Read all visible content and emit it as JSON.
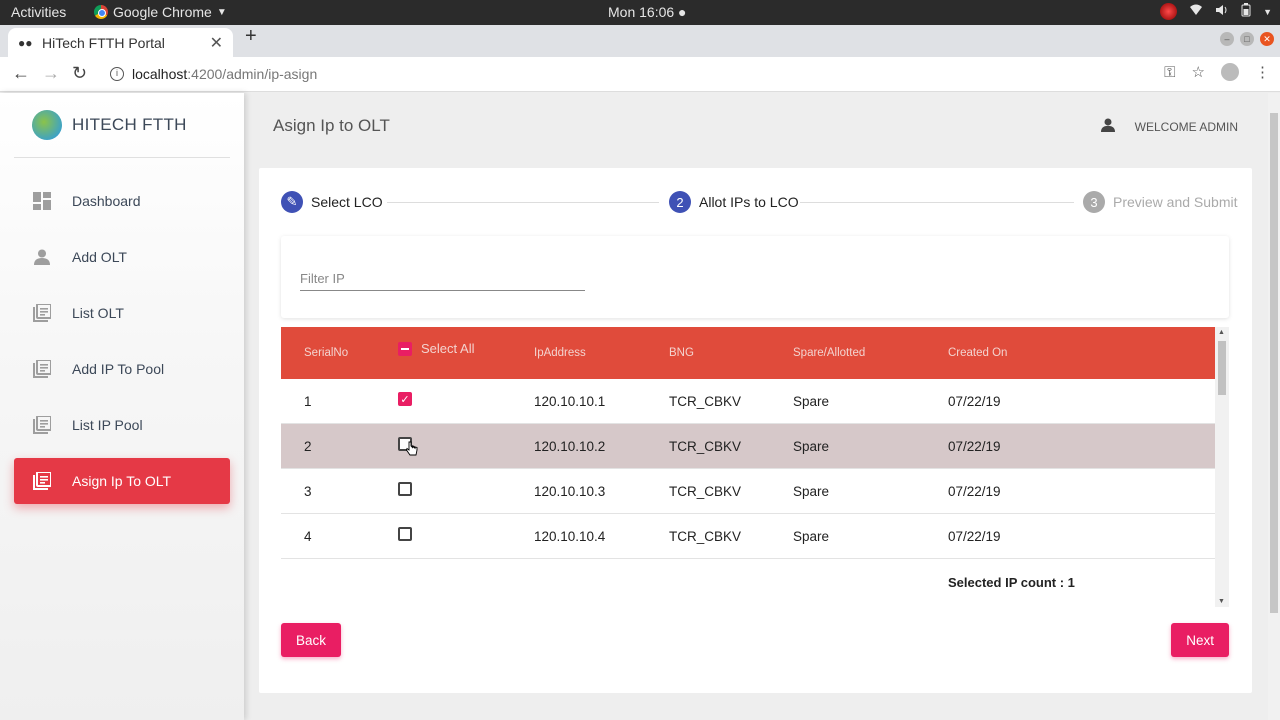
{
  "os": {
    "activities": "Activities",
    "app_name": "Google Chrome",
    "clock": "Mon 16:06 ●"
  },
  "browser": {
    "tab_title": "HiTech FTTH Portal",
    "url_host": "localhost",
    "url_path": ":4200/admin/ip-asign"
  },
  "sidebar": {
    "brand": "HITECH FTTH",
    "items": [
      {
        "label": "Dashboard",
        "icon": "dashboard-icon"
      },
      {
        "label": "Add OLT",
        "icon": "person-icon"
      },
      {
        "label": "List OLT",
        "icon": "library-books-icon"
      },
      {
        "label": "Add IP To Pool",
        "icon": "library-books-icon"
      },
      {
        "label": "List IP Pool",
        "icon": "library-books-icon"
      },
      {
        "label": "Asign Ip To OLT",
        "icon": "library-books-icon",
        "active": true
      }
    ]
  },
  "header": {
    "title": "Asign Ip to OLT",
    "welcome": "WELCOME ADMIN"
  },
  "stepper": {
    "steps": [
      {
        "num": "✎",
        "label": "Select LCO",
        "state": "done"
      },
      {
        "num": "2",
        "label": "Allot IPs to LCO",
        "state": "active"
      },
      {
        "num": "3",
        "label": "Preview and Submit",
        "state": "inactive"
      }
    ]
  },
  "filter": {
    "placeholder": "Filter IP"
  },
  "table": {
    "columns": [
      "SerialNo",
      "Select All",
      "IpAddress",
      "BNG",
      "Spare/Allotted",
      "Created On"
    ],
    "rows": [
      {
        "serial": "1",
        "checked": true,
        "ip": "120.10.10.1",
        "bng": "TCR_CBKV",
        "status": "Spare",
        "created": "07/22/19"
      },
      {
        "serial": "2",
        "checked": false,
        "ip": "120.10.10.2",
        "bng": "TCR_CBKV",
        "status": "Spare",
        "created": "07/22/19"
      },
      {
        "serial": "3",
        "checked": false,
        "ip": "120.10.10.3",
        "bng": "TCR_CBKV",
        "status": "Spare",
        "created": "07/22/19"
      },
      {
        "serial": "4",
        "checked": false,
        "ip": "120.10.10.4",
        "bng": "TCR_CBKV",
        "status": "Spare",
        "created": "07/22/19"
      }
    ],
    "selected_count": "Selected IP count : 1"
  },
  "actions": {
    "back": "Back",
    "next": "Next"
  },
  "colors": {
    "accent_pink": "#e91e63",
    "table_header": "#e04b3b",
    "sidebar_active": "#e53946",
    "stepper_blue": "#3f51b5"
  }
}
